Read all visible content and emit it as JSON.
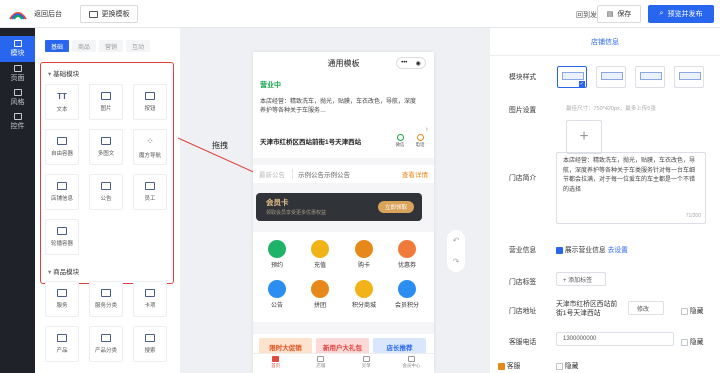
{
  "topbar": {
    "back_label": "返回后台",
    "template_label": "更换模板",
    "return_publish": "回到发布版",
    "save_label": "保存",
    "publish_label": "预览并发布"
  },
  "leftnav": {
    "items": [
      {
        "label": "模块"
      },
      {
        "label": "页面"
      },
      {
        "label": "风格"
      },
      {
        "label": "控件"
      }
    ]
  },
  "panel": {
    "tabs": [
      "基础",
      "商品",
      "营销",
      "互动"
    ],
    "basic_title": "基础模块",
    "basic_items": [
      "文本",
      "图片",
      "按钮",
      "自由容器",
      "多图文",
      "魔方导航",
      "店铺信息",
      "公告",
      "员工",
      "轮播容器"
    ],
    "goods_title": "商品模块",
    "goods_items": [
      "服务",
      "服务分类",
      "卡项",
      "产品",
      "产品分类",
      "搜索"
    ]
  },
  "drag_label": "拖拽",
  "phone": {
    "title": "通用模板",
    "status": "营业中",
    "intro": "本店经营：精致洗车，抛光，贴膜，车衣改色，导航，深度养护等各种关于车服务…",
    "address": "天津市红桥区西站前街1号天津西站",
    "wechat": "微信",
    "phone": "电话",
    "notice_label": "最新公告",
    "notice_text": "示例公告示例公告",
    "notice_detail": "查看详情",
    "member_title": "会员卡",
    "member_sub": "领取会员享受更多优惠权益",
    "member_btn": "立即领取",
    "entries": [
      "预约",
      "充值",
      "购卡",
      "优惠券",
      "公告",
      "拼团",
      "积分商城",
      "会员积分"
    ],
    "promos": [
      "限时大促销",
      "新用户大礼包",
      "店长推荐"
    ],
    "tabbar": [
      "首页",
      "店铺",
      "买单",
      "会员中心"
    ]
  },
  "right": {
    "header": "店铺信息",
    "module_style": "模块样式",
    "image_setting": "图片设置",
    "image_hint": "最佳尺寸：750*420px，最多上传5张",
    "intro_label": "门店简介",
    "intro_text": "本店经营：精致洗车，抛光，贴膜，车衣改色，导航，深度养护等各种关于车类服务针对每一台车细节都会拉满，对于每一位爱车的车主都是一个不错的选择",
    "intro_count": "71/200",
    "business_label": "营业信息",
    "business_check": "展示营业信息",
    "business_link": "去设置",
    "tag_label": "门店标签",
    "tag_add": "+ 添加标签",
    "address_label": "门店地址",
    "address_value": "天津市红桥区西站前街1号天津西站",
    "modify": "修改",
    "hide": "隐藏",
    "phone_label": "客服电话",
    "phone_value": "1300000000",
    "service_label": "客服",
    "hide2": "隐藏"
  },
  "colors": {
    "accent": "#2866f0",
    "dark": "#20222a",
    "highlight": "#e0403a",
    "open": "#17a54a"
  }
}
